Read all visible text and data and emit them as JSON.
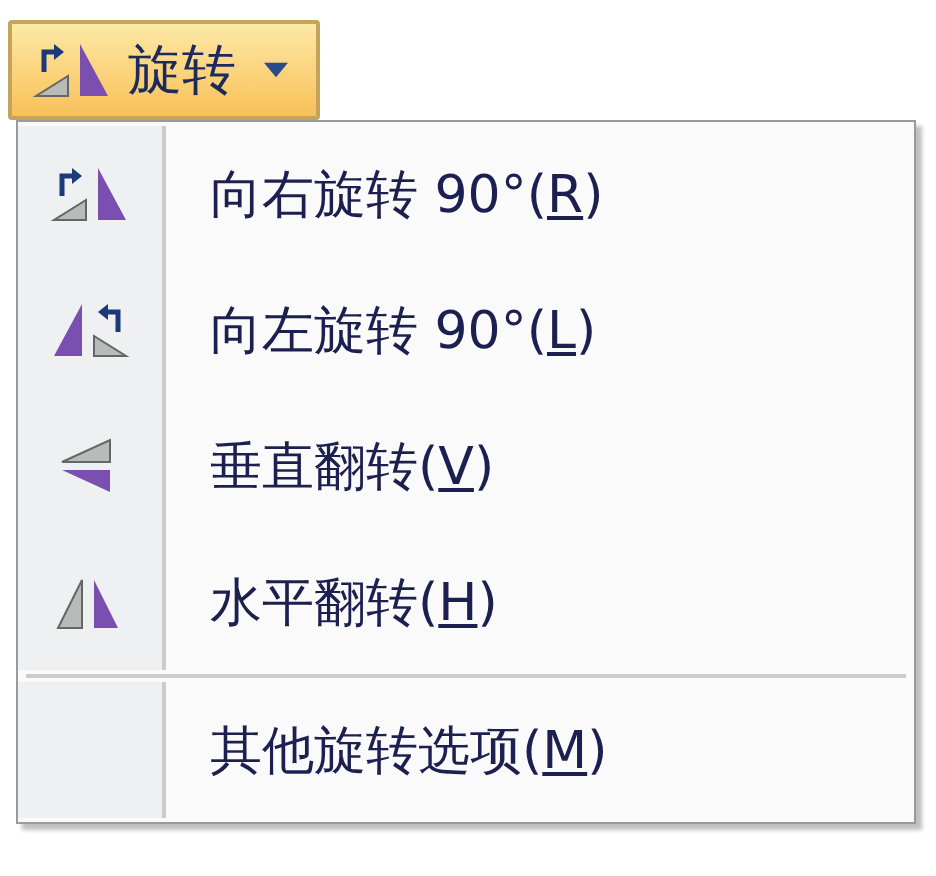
{
  "rotate_button": {
    "label": "旋转",
    "expanded": true
  },
  "menu": {
    "items": [
      {
        "kind": "rotate-right",
        "text_before": "向右旋转 90°(",
        "mnemonic": "R",
        "text_after": ")"
      },
      {
        "kind": "rotate-left",
        "text_before": "向左旋转 90°(",
        "mnemonic": "L",
        "text_after": ")"
      },
      {
        "kind": "flip-vertical",
        "text_before": "垂直翻转(",
        "mnemonic": "V",
        "text_after": ")"
      },
      {
        "kind": "flip-horizontal",
        "text_before": "水平翻转(",
        "mnemonic": "H",
        "text_after": ")"
      },
      {
        "kind": "separator"
      },
      {
        "kind": "plain",
        "text_before": "其他旋转选项(",
        "mnemonic": "M",
        "text_after": ")"
      }
    ]
  }
}
